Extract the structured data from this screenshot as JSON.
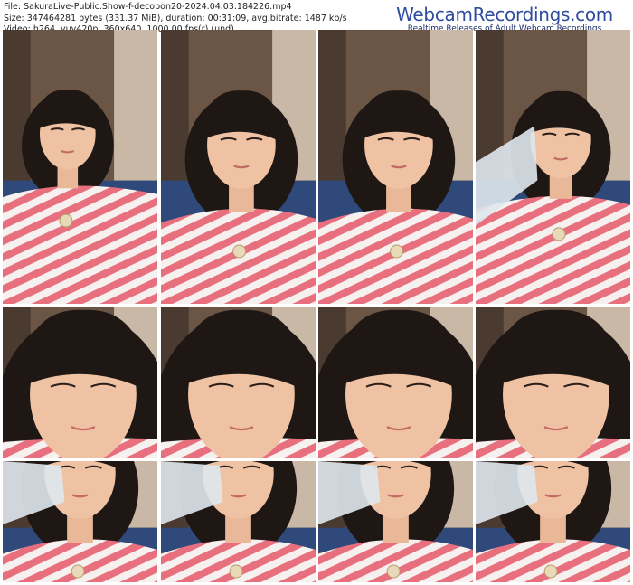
{
  "meta": {
    "file": "File: SakuraLive-Public.Show-f-decopon20-2024.04.03.184226.mp4",
    "size": "Size: 347464281 bytes (331.37 MiB), duration: 00:31:09, avg.bitrate: 1487 kb/s",
    "video": "Video: h264, yuv420p, 360x640, 1000.00 fps(r) (und)"
  },
  "brand": {
    "name": "WebcamRecordings.com",
    "tagline": "Realtime Releases of Adult Webcam Recordings"
  },
  "colors": {
    "brand_blue": "#2f4d9e",
    "stripe_pink": "#e8707e",
    "stripe_white": "#f6f0ee",
    "skin": "#f0c2a4",
    "hair": "#1e1714",
    "sofa_blue": "#2f4a7a"
  },
  "thumbnails": [
    {
      "row": 0,
      "col": 0,
      "scene": "profile"
    },
    {
      "row": 0,
      "col": 1,
      "scene": "front"
    },
    {
      "row": 0,
      "col": 2,
      "scene": "front"
    },
    {
      "row": 0,
      "col": 3,
      "scene": "drinking"
    },
    {
      "row": 1,
      "col": 0,
      "scene": "closeup"
    },
    {
      "row": 1,
      "col": 1,
      "scene": "closeup"
    },
    {
      "row": 1,
      "col": 2,
      "scene": "closeup"
    },
    {
      "row": 1,
      "col": 3,
      "scene": "closeup"
    },
    {
      "row": 2,
      "col": 0,
      "scene": "drinking-low"
    },
    {
      "row": 2,
      "col": 1,
      "scene": "drinking-low"
    },
    {
      "row": 2,
      "col": 2,
      "scene": "drinking-low"
    },
    {
      "row": 2,
      "col": 3,
      "scene": "drinking-low"
    }
  ]
}
